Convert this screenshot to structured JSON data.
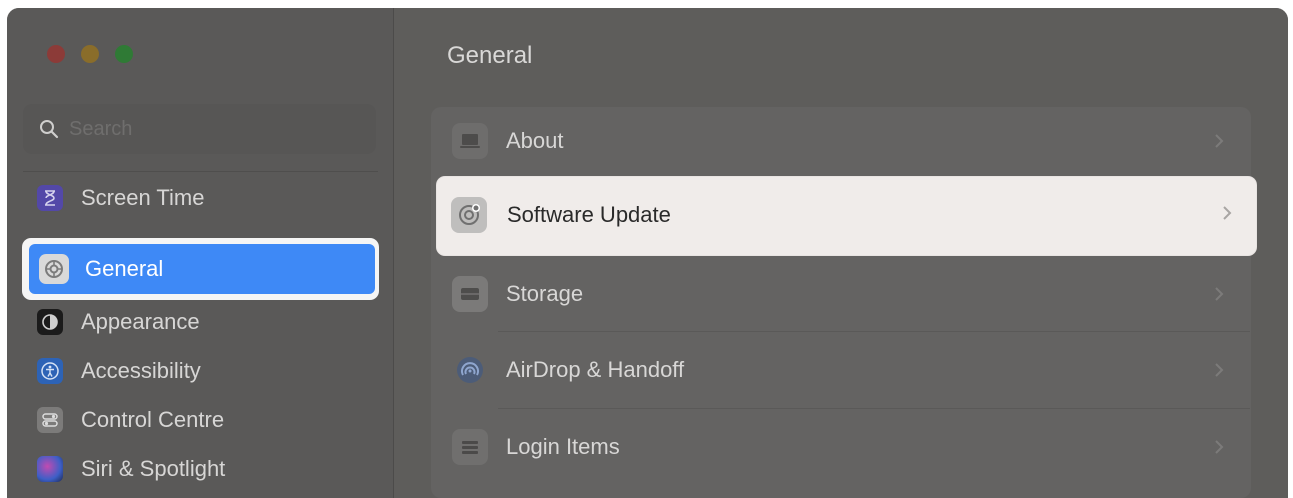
{
  "sidebar": {
    "search": {
      "placeholder": "Search"
    },
    "items": [
      {
        "label": "Screen Time",
        "icon": "hourglass-icon"
      },
      {
        "label": "General",
        "icon": "gear-icon",
        "selected": true
      },
      {
        "label": "Appearance",
        "icon": "appearance-icon"
      },
      {
        "label": "Accessibility",
        "icon": "accessibility-icon"
      },
      {
        "label": "Control Centre",
        "icon": "control-centre-icon"
      },
      {
        "label": "Siri & Spotlight",
        "icon": "siri-icon"
      }
    ]
  },
  "main": {
    "title": "General",
    "rows": [
      {
        "label": "About",
        "icon": "laptop-icon"
      },
      {
        "label": "Software Update",
        "icon": "software-update-gear-icon",
        "highlighted": true
      },
      {
        "label": "Storage",
        "icon": "storage-icon"
      },
      {
        "label": "AirDrop & Handoff",
        "icon": "airdrop-icon"
      },
      {
        "label": "Login Items",
        "icon": "list-icon"
      }
    ]
  },
  "colors": {
    "accent": "#3e89f6",
    "window_bg": "#5e5d5b",
    "highlight_bg": "#f0ecea"
  }
}
